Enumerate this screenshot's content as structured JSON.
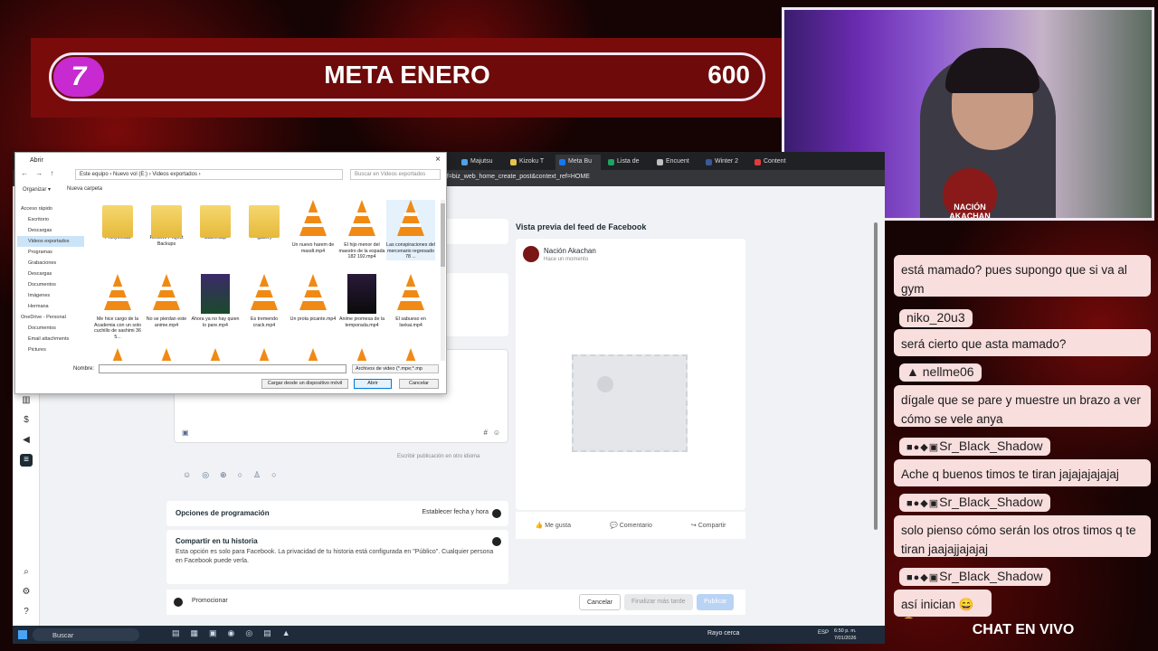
{
  "overlay": {
    "goal_number": "7",
    "goal_title": "META ENERO",
    "goal_target": "600",
    "chat_footer": "CHAT EN VIVO",
    "cam_logo": "NACIÓN AKACHAN"
  },
  "browser": {
    "tabs": [
      {
        "label": "Majutsu",
        "color": "#4ea0e8"
      },
      {
        "label": "Kizoku T",
        "color": "#e8c34e"
      },
      {
        "label": "Meta Bu",
        "color": "#1877f2",
        "active": true
      },
      {
        "label": "Lista de",
        "color": "#1ea362"
      },
      {
        "label": "Encuent",
        "color": "#c0c0c0"
      },
      {
        "label": "Winter 2",
        "color": "#3b5998"
      },
      {
        "label": "Content",
        "color": "#e23b3b"
      }
    ],
    "url": "ef=biz_web_home_create_post&context_ref=HOME"
  },
  "facebook": {
    "preview_title": "Vista previa del feed de Facebook",
    "page_name": "Nación Akachan",
    "post_time": "Hace un momento",
    "like": "Me gusta",
    "comment": "Comentario",
    "share": "Compartir",
    "write_other_lang": "Escribir publicación en otro idioma",
    "schedule_label": "Opciones de programación",
    "schedule_toggle_label": "Establecer fecha y hora",
    "story_title": "Compartir en tu historia",
    "story_desc": "Esta opción es solo para Facebook. La privacidad de tu historia está configurada en \"Público\". Cualquier persona en Facebook puede verla.",
    "promote": "Promocionar",
    "cancel": "Cancelar",
    "finish_later": "Finalizar más tarde",
    "publish": "Publicar"
  },
  "dialog": {
    "title": "Abrir",
    "path": "Este equipo  ›  Nuevo vol (E:)  ›  Videos exportados  ›",
    "search_placeholder": "Buscar en Videos exportados",
    "organize": "Organizar ▾",
    "new_folder": "Nueva carpeta",
    "tree": [
      "Acceso rápido",
      "Escritorio",
      "Descargas",
      "Videos exportados",
      "Programas",
      "Grabaciones",
      "Descargas",
      "Documentos",
      "Imágenes",
      "Hermana",
      "OneDrive - Personal",
      "Documentos",
      "Email attachments",
      "Pictures"
    ],
    "items": [
      {
        "name": "ProxyMedia",
        "kind": "folder"
      },
      {
        "name": "Resolve Project Backups",
        "kind": "folder"
      },
      {
        "name": "CacheClip",
        "kind": "folder"
      },
      {
        "name": ".gallery",
        "kind": "folder"
      },
      {
        "name": "Un nuevo harem de masdt.mp4",
        "kind": "vlc"
      },
      {
        "name": "El hijo menor del maestro de la espada 182 192.mp4",
        "kind": "vlc"
      },
      {
        "name": "Las conspiraciones del mercenario regresado 78 ...",
        "kind": "vlc"
      },
      {
        "name": "Me hice cargo de la Academia con un solo cuchillo de sashimi 36 5...",
        "kind": "vlc"
      },
      {
        "name": "No se pierdan este anime.mp4",
        "kind": "vlc"
      },
      {
        "name": "Ahora ya no hay quien lo pare.mp4",
        "kind": "thumb"
      },
      {
        "name": "Es tremendo crack.mp4",
        "kind": "vlc"
      },
      {
        "name": "Un prota picante.mp4",
        "kind": "vlc"
      },
      {
        "name": "Anime promesa de la temporada.mp4",
        "kind": "thumb-dark"
      },
      {
        "name": "El sabueso en Isekai.mp4",
        "kind": "vlc"
      }
    ],
    "name_label": "Nombre:",
    "file_type": "Archivos de video (*.mpe;*.mp",
    "load_from_device": "Cargar desde un dispositivo móvil",
    "open": "Abrir",
    "cancel": "Cancelar"
  },
  "chat": {
    "messages": [
      {
        "user": "",
        "text": "está mamado? pues supongo que si va al gym"
      },
      {
        "user": "niko_20u3",
        "text": "será cierto que asta mamado?"
      },
      {
        "user": "nellme06",
        "text": "dígale que se pare y muestre un brazo a ver cómo se vele anya"
      },
      {
        "user": "Sr_Black_Shadow",
        "text": "Ache q buenos timos te tiran jajajajajajaj"
      },
      {
        "user": "Sr_Black_Shadow",
        "text": "solo pienso cómo serán los otros timos q te tiran jaajajjajajaj"
      },
      {
        "user": "Sr_Black_Shadow",
        "text": "así inician 😄😄"
      }
    ]
  },
  "taskbar": {
    "search": "Buscar",
    "weather": "Rayo cerca",
    "lang": "ESP",
    "time": "6:50 p. m.",
    "date": "7/01/2026"
  }
}
